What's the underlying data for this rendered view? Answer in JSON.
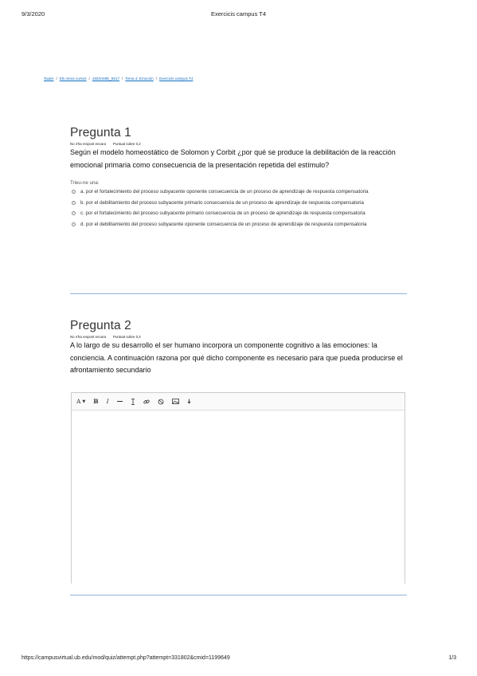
{
  "print_header": {
    "date": "9/3/2020",
    "title": "Exercicis campus T4"
  },
  "breadcrumb": {
    "items": [
      "Tauler",
      "Els meus cursos",
      "1920AMIE_5517",
      "Tema 4: Emoción",
      "Exercicis campus T4"
    ],
    "separator": "/"
  },
  "question1": {
    "title": "Pregunta 1",
    "status": "No s'ha respost encara",
    "grade": "Puntuat sobre 0,2",
    "text": "Según el modelo homeostático de Solomon y Corbit ¿por qué se produce la debilitación de la reacción emocional primaria como consecuencia de la presentación repetida del estímulo?",
    "prompt": "Trieu-ne una:",
    "answers": [
      "a. por el fortalecimiento del proceso subyacente oponente consecuencia de un proceso de aprendizaje de respuesta compensatoria",
      "b. por el debilitamiento del proceso subyacente primario consecuencia de un proceso de aprendizaje de respuesta compensatoria",
      "c. por el fortalecimiento del proceso subyacente primario consecuencia de un proceso de aprendizaje de respuesta compensatoria",
      "d. por el debilitamiento del proceso subyacente oponente consecuencia de un proceso de aprendizaje de respuesta compensatoria"
    ]
  },
  "question2": {
    "title": "Pregunta 2",
    "status": "No s'ha respost encara",
    "grade": "Puntuat sobre 0,4",
    "text": "A lo largo de su desarrollo el ser humano incorpora un componente cognitivo a las emociones: la  conciencia. A continuación razona por qué dicho componente es necesario para que pueda producirse el afrontamiento secundario",
    "editor_toolbar": [
      "font-size-icon",
      "bold-icon",
      "italic-icon",
      "unordered-list-icon",
      "ordered-list-icon",
      "link-icon",
      "unlink-icon",
      "image-icon",
      "media-icon"
    ],
    "answer_value": ""
  },
  "print_footer": {
    "url": "https://campusvirtual.ub.edu/mod/quiz/attempt.php?attempt=331802&cmid=1199649",
    "page": "1/3"
  },
  "colors": {
    "link": "#0f6fc5",
    "divider": "#8fb3db"
  }
}
